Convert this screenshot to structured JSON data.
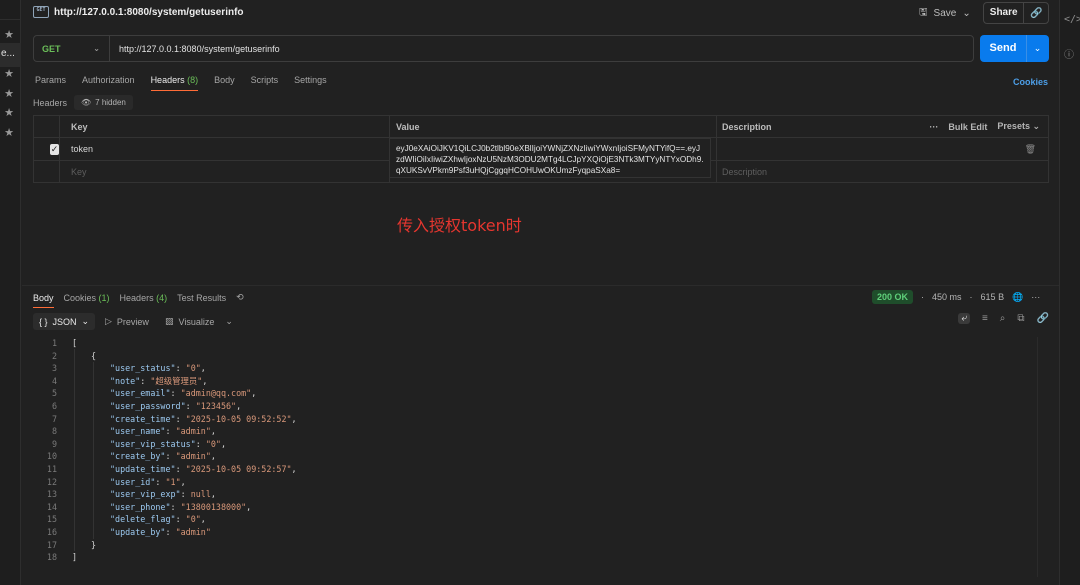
{
  "tab": {
    "title": "http://127.0.0.1:8080/system/getuserinfo",
    "badge": "GET"
  },
  "toolbar": {
    "save_label": "Save",
    "share_label": "Share"
  },
  "request": {
    "method": "GET",
    "url": "http://127.0.0.1:8080/system/getuserinfo",
    "send_label": "Send"
  },
  "request_tabs": [
    {
      "label": "Params"
    },
    {
      "label": "Authorization"
    },
    {
      "label": "Headers",
      "count": "(8)"
    },
    {
      "label": "Body"
    },
    {
      "label": "Scripts"
    },
    {
      "label": "Settings"
    }
  ],
  "cookies_label": "Cookies",
  "headers_section": {
    "label": "Headers",
    "hidden": "7 hidden"
  },
  "headers_table": {
    "col_key": "Key",
    "col_value": "Value",
    "col_desc": "Description",
    "bulk_edit": "Bulk Edit",
    "presets": "Presets",
    "rows": [
      {
        "key": "token",
        "value": "eyJ0eXAiOiJKV1QiLCJ0b2tlbl90eXBlIjoiYWNjZXNzIiwiYWxnIjoiSFMyNTYifQ==.eyJzdWIiOiIxIiwiZXhwIjoxNzU5NzM3ODU2MTg4LCJpYXQiOjE3NTk3MTYyNTYxODh9.qXUKSvVPkm9Psf3uHQjCggqHCOHUwOKUmzFyqpaSXa8="
      }
    ],
    "placeholder_key": "Key",
    "placeholder_desc": "Description"
  },
  "annotation": "传入授权token时",
  "response_tabs": [
    {
      "label": "Body"
    },
    {
      "label": "Cookies",
      "count": "(1)"
    },
    {
      "label": "Headers",
      "count": "(4)"
    },
    {
      "label": "Test Results"
    }
  ],
  "response_status": {
    "code": "200 OK",
    "time": "450 ms",
    "size": "615 B"
  },
  "response_toolbar": {
    "format": "JSON",
    "preview": "Preview",
    "visualize": "Visualize"
  },
  "response_body": {
    "lines": [
      {
        "n": "1",
        "indent": 0,
        "parts": [
          [
            "p",
            "["
          ]
        ]
      },
      {
        "n": "2",
        "indent": 1,
        "parts": [
          [
            "p",
            "{"
          ]
        ]
      },
      {
        "n": "3",
        "indent": 2,
        "parts": [
          [
            "k",
            "\"user_status\""
          ],
          [
            "p",
            ": "
          ],
          [
            "s",
            "\"0\""
          ],
          [
            "p",
            ","
          ]
        ]
      },
      {
        "n": "4",
        "indent": 2,
        "parts": [
          [
            "k",
            "\"note\""
          ],
          [
            "p",
            ": "
          ],
          [
            "s",
            "\"超级管理员\""
          ],
          [
            "p",
            ","
          ]
        ]
      },
      {
        "n": "5",
        "indent": 2,
        "parts": [
          [
            "k",
            "\"user_email\""
          ],
          [
            "p",
            ": "
          ],
          [
            "s",
            "\"admin@qq.com\""
          ],
          [
            "p",
            ","
          ]
        ]
      },
      {
        "n": "6",
        "indent": 2,
        "parts": [
          [
            "k",
            "\"user_password\""
          ],
          [
            "p",
            ": "
          ],
          [
            "s",
            "\"123456\""
          ],
          [
            "p",
            ","
          ]
        ]
      },
      {
        "n": "7",
        "indent": 2,
        "parts": [
          [
            "k",
            "\"create_time\""
          ],
          [
            "p",
            ": "
          ],
          [
            "s",
            "\"2025-10-05 09:52:52\""
          ],
          [
            "p",
            ","
          ]
        ]
      },
      {
        "n": "8",
        "indent": 2,
        "parts": [
          [
            "k",
            "\"user_name\""
          ],
          [
            "p",
            ": "
          ],
          [
            "s",
            "\"admin\""
          ],
          [
            "p",
            ","
          ]
        ]
      },
      {
        "n": "9",
        "indent": 2,
        "parts": [
          [
            "k",
            "\"user_vip_status\""
          ],
          [
            "p",
            ": "
          ],
          [
            "s",
            "\"0\""
          ],
          [
            "p",
            ","
          ]
        ]
      },
      {
        "n": "10",
        "indent": 2,
        "parts": [
          [
            "k",
            "\"create_by\""
          ],
          [
            "p",
            ": "
          ],
          [
            "s",
            "\"admin\""
          ],
          [
            "p",
            ","
          ]
        ]
      },
      {
        "n": "11",
        "indent": 2,
        "parts": [
          [
            "k",
            "\"update_time\""
          ],
          [
            "p",
            ": "
          ],
          [
            "s",
            "\"2025-10-05 09:52:57\""
          ],
          [
            "p",
            ","
          ]
        ]
      },
      {
        "n": "12",
        "indent": 2,
        "parts": [
          [
            "k",
            "\"user_id\""
          ],
          [
            "p",
            ": "
          ],
          [
            "s",
            "\"1\""
          ],
          [
            "p",
            ","
          ]
        ]
      },
      {
        "n": "13",
        "indent": 2,
        "parts": [
          [
            "k",
            "\"user_vip_exp\""
          ],
          [
            "p",
            ": "
          ],
          [
            "n",
            "null"
          ],
          [
            "p",
            ","
          ]
        ]
      },
      {
        "n": "14",
        "indent": 2,
        "parts": [
          [
            "k",
            "\"user_phone\""
          ],
          [
            "p",
            ": "
          ],
          [
            "s",
            "\"13800138000\""
          ],
          [
            "p",
            ","
          ]
        ]
      },
      {
        "n": "15",
        "indent": 2,
        "parts": [
          [
            "k",
            "\"delete_flag\""
          ],
          [
            "p",
            ": "
          ],
          [
            "s",
            "\"0\""
          ],
          [
            "p",
            ","
          ]
        ]
      },
      {
        "n": "16",
        "indent": 2,
        "parts": [
          [
            "k",
            "\"update_by\""
          ],
          [
            "p",
            ": "
          ],
          [
            "s",
            "\"admin\""
          ]
        ]
      },
      {
        "n": "17",
        "indent": 1,
        "parts": [
          [
            "p",
            "}"
          ]
        ]
      },
      {
        "n": "18",
        "indent": 0,
        "parts": [
          [
            "p",
            "]"
          ]
        ]
      }
    ]
  },
  "left_strip": {
    "item_text": "e..."
  },
  "icons": {
    "save": "save-icon",
    "link": "link-icon",
    "eye": "eye-icon",
    "history": "history-icon",
    "globe": "globe-icon",
    "more": "more-icon",
    "trash": "trash-icon",
    "filter": "filter-icon",
    "search": "search-icon",
    "copy": "copy-icon",
    "wrap": "wrap-icon",
    "code": "code-icon"
  }
}
